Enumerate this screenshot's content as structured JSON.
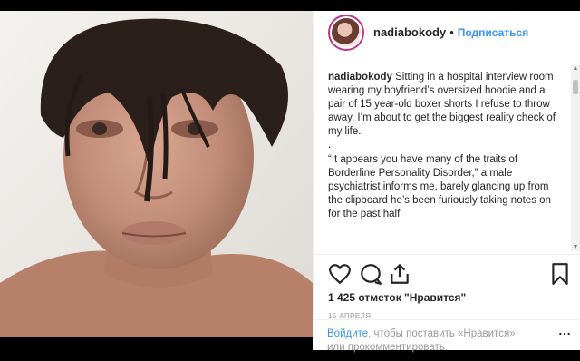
{
  "post": {
    "username": "nadiabokody",
    "dot": "•",
    "follow_label": "Подписаться",
    "caption": {
      "username": "nadiabokody",
      "line1": " Sitting in a hospital interview room wearing my boyfriend’s oversized hoodie and a pair of 15 year-old boxer shorts I refuse to throw away, I’m about to get the biggest reality check of my life.",
      "dot_line": ".",
      "line2": "“It appears you have many of the traits of Borderline Personality Disorder,” a male psychiatrist informs me, barely glancing up from the clipboard he’s been furiously taking notes on for the past half"
    },
    "likes": "1 425 отметок \"Нравится\"",
    "date": "15 АПРЕЛЯ",
    "login_link": "Войдите",
    "login_rest": ", чтобы поставить «Нравится» или прокомментировать."
  },
  "icons": {
    "like": "heart-icon",
    "comment": "comment-icon",
    "share": "share-icon",
    "save": "bookmark-icon",
    "more": "more-icon"
  },
  "colors": {
    "link": "#3897f0",
    "text": "#262626",
    "muted": "#999999",
    "border": "#efefef"
  }
}
